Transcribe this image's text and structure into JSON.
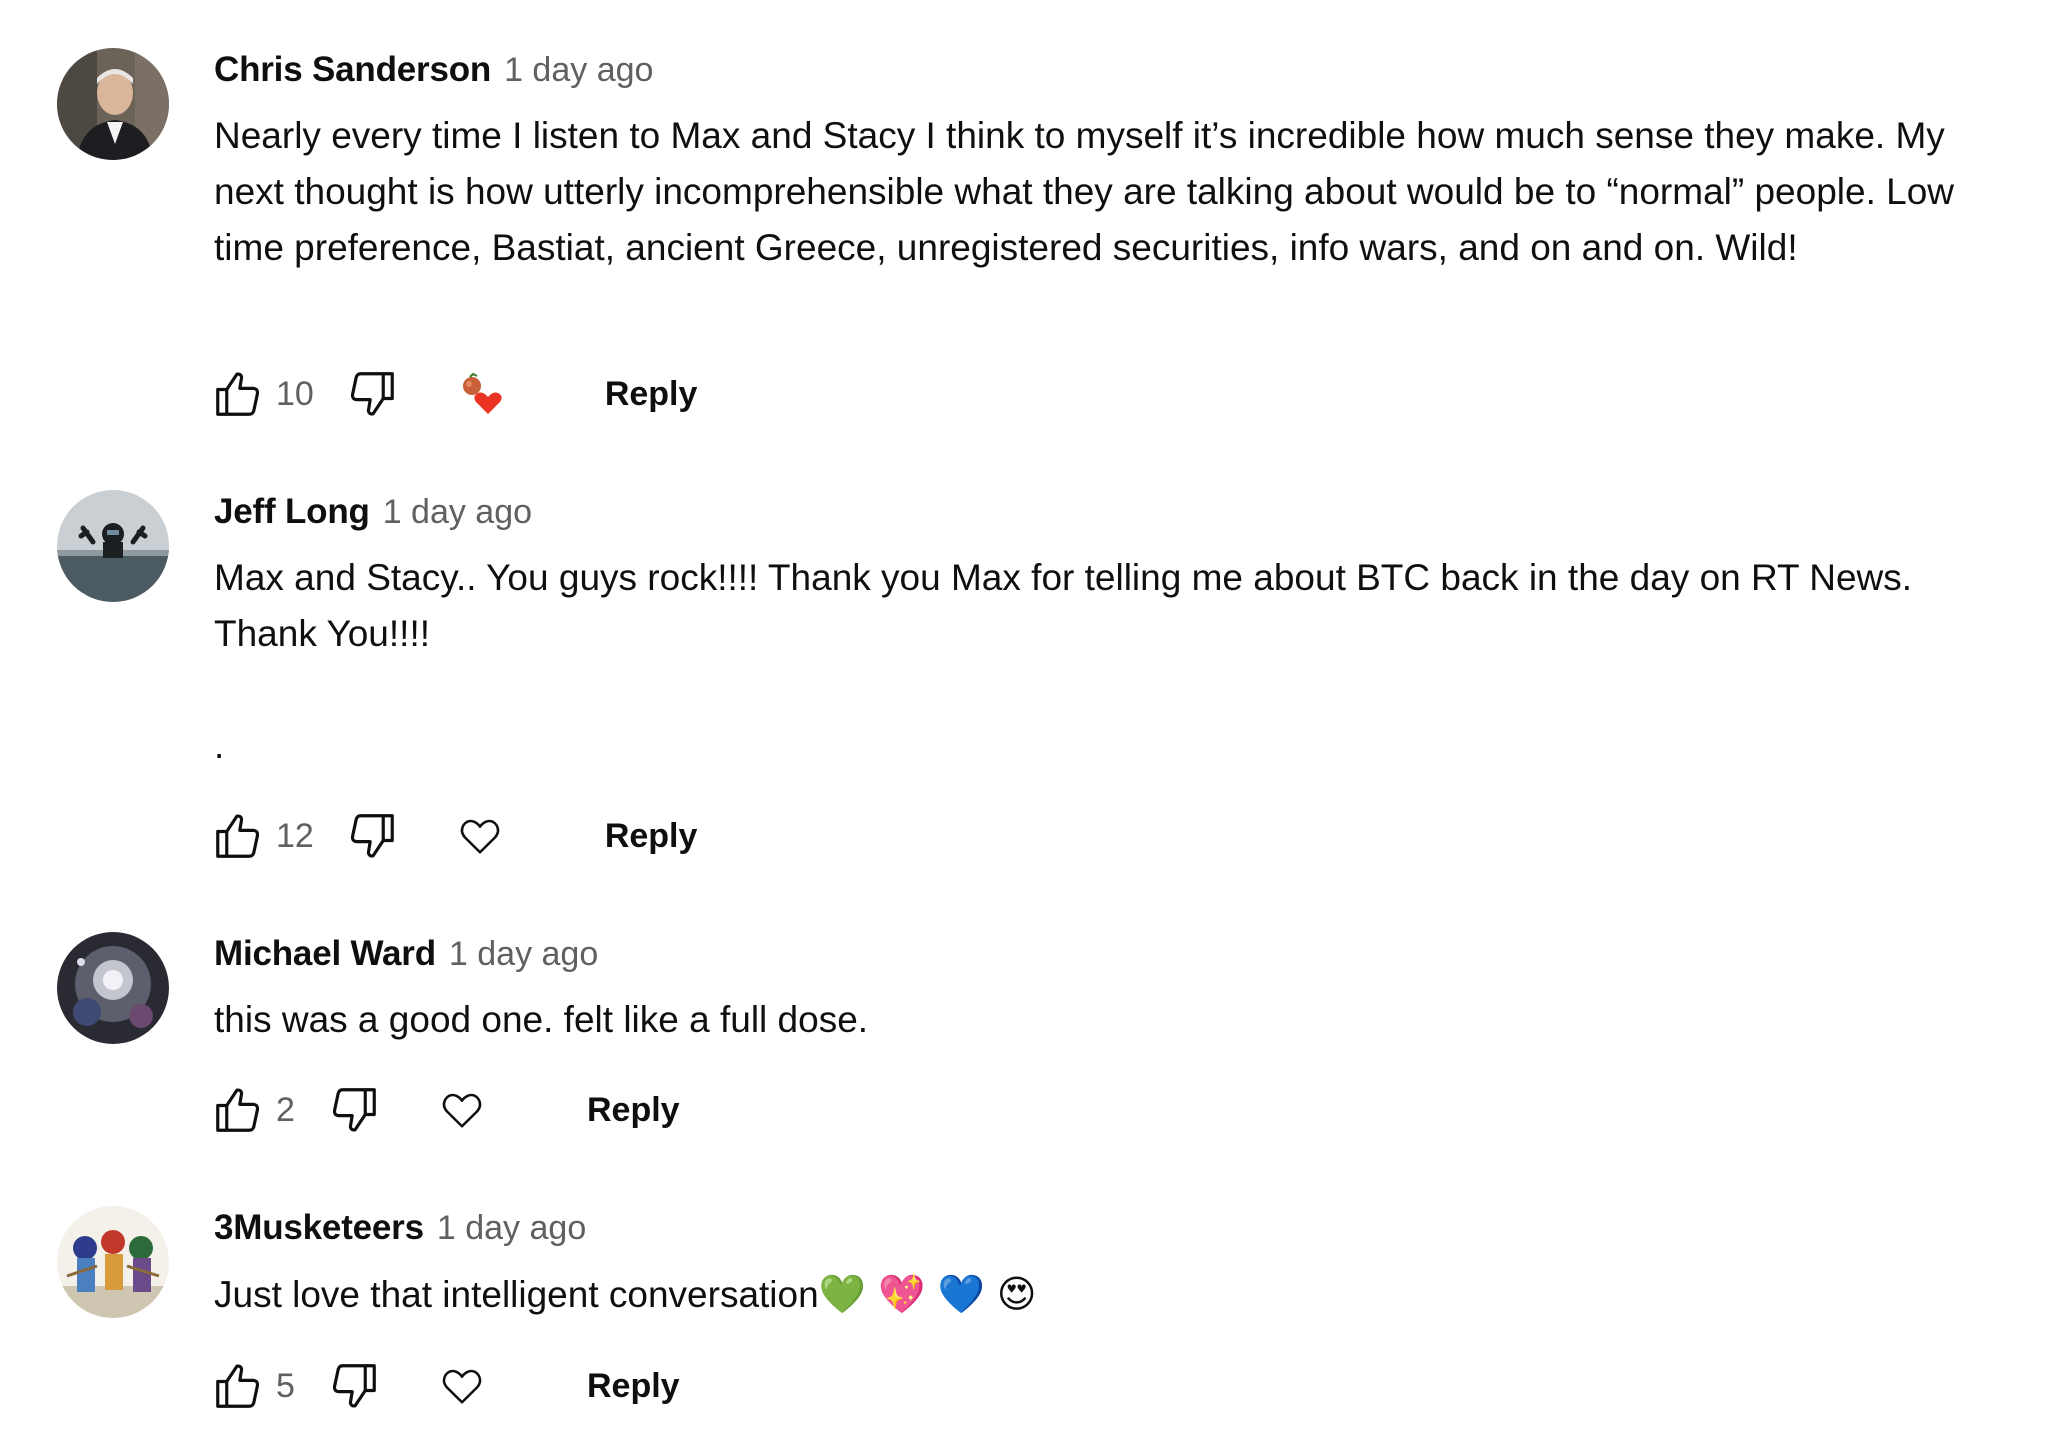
{
  "reply_label": "Reply",
  "colors": {
    "text": "#0f0f0f",
    "secondary": "#606060",
    "heart_red": "#ea3323"
  },
  "comments": [
    {
      "author": "Chris Sanderson",
      "time": "1 day ago",
      "text": "Nearly every time I listen to Max and Stacy I think to myself it’s incredible how much sense they make. My next thought is how utterly incomprehensible what they are talking about would be to “normal” people. Low time preference, Bastiat, ancient Greece, unregistered securities, info wars, and on and on. Wild!",
      "likes": "10",
      "creator_hearted": true
    },
    {
      "author": "Jeff Long",
      "time": "1 day ago",
      "text": "Max and Stacy.. You guys rock!!!! Thank you Max for telling me about BTC back in the day on RT News. Thank You!!!!\n\n.",
      "likes": "12",
      "creator_hearted": false
    },
    {
      "author": "Michael Ward",
      "time": "1 day ago",
      "text": "this was a good one. felt like a full dose.",
      "likes": "2",
      "creator_hearted": false
    },
    {
      "author": "3Musketeers",
      "time": "1 day ago",
      "text": "Just love that intelligent conversation",
      "emojis": "💚 💖 💙 😍",
      "likes": "5",
      "creator_hearted": false
    }
  ]
}
